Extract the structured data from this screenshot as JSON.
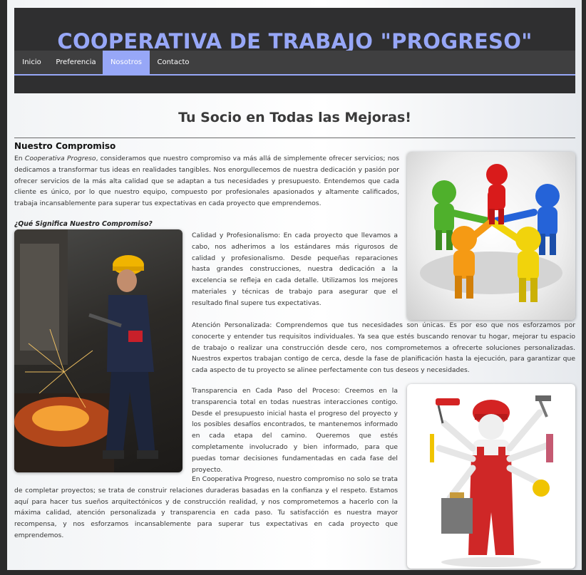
{
  "header": {
    "title": "COOPERATIVA DE TRABAJO \"PROGRESO\""
  },
  "nav": {
    "items": [
      "Inicio",
      "Preferencia",
      "Nosotros",
      "Contacto"
    ],
    "active": "Nosotros"
  },
  "colors": {
    "accent": "#97a7f7",
    "header_bg": "#2f2f30",
    "nav_bg": "#3f3f40"
  },
  "main": {
    "headline": "Tu Socio en Todas las Mejoras!",
    "section_title": "Nuestro Compromiso",
    "intro": {
      "prefix": "En ",
      "company": "Cooperativa Progreso",
      "rest": ", consideramos que nuestro compromiso va más allá de simplemente ofrecer servicios; nos dedicamos a transformar tus ideas en realidades tangibles. Nos enorgullecemos de nuestra dedicación y pasión por ofrecer servicios de la más alta calidad que se adaptan a tus necesidades y presupuesto. Entendemos que cada cliente es único, por lo que nuestro equipo, compuesto por profesionales apasionados y altamente calificados, trabaja incansablemente para superar tus expectativas en cada proyecto que emprendemos."
    },
    "subheading": "¿Qué Significa Nuestro Compromiso?",
    "quality": "Calidad y Profesionalismo: En cada proyecto que llevamos a cabo, nos adherimos a los estándares más rigurosos de calidad y profesionalismo. Desde pequeñas reparaciones hasta grandes construcciones, nuestra dedicación a la excelencia se refleja en cada detalle. Utilizamos los mejores materiales y técnicas de trabajo para asegurar que el resultado final supere tus expectativas.",
    "attention_top": "Atención Personalizada: Comprendemos que tus necesidades son únicas. Es por eso que nos esforzamos por conocerte y entender tus requisitos individuales. Ya sea que estés buscando renovar tu hogar, mejorar tu espacio de trabajo o realizar una construcción desde cero, nos comprometemos a ofrecerte soluciones personalizadas. Nuestros expertos trabajan contigo de cerca, desde la fase de planificación hasta la ejecución, para garantizar que cada aspecto de tu proyecto se alinee perfectamente con tus deseos y necesidades.",
    "transparency": "Transparencia en Cada Paso del Proceso: Creemos en la transparencia total en todas nuestras interacciones contigo. Desde el presupuesto inicial hasta el progreso del proyecto y los posibles desafíos encontrados, te mantenemos informado en cada etapa del camino. Queremos que estés completamente involucrado y bien informado, para que puedas tomar decisiones fundamentadas en cada fase del proyecto.",
    "closing": "En Cooperativa Progreso, nuestro compromiso no solo se trata de completar proyectos; se trata de construir relaciones duraderas basadas en la confianza y el respeto. Estamos aquí para hacer tus sueños arquitectónicos y de construcción realidad, y nos comprometemos a hacerlo con la máxima calidad, atención personalizada y transparencia en cada paso. Tu satisfacción es nuestra mayor recompensa, y nos esforzamos incansablemente para superar tus expectativas en cada proyecto que emprendemos."
  }
}
